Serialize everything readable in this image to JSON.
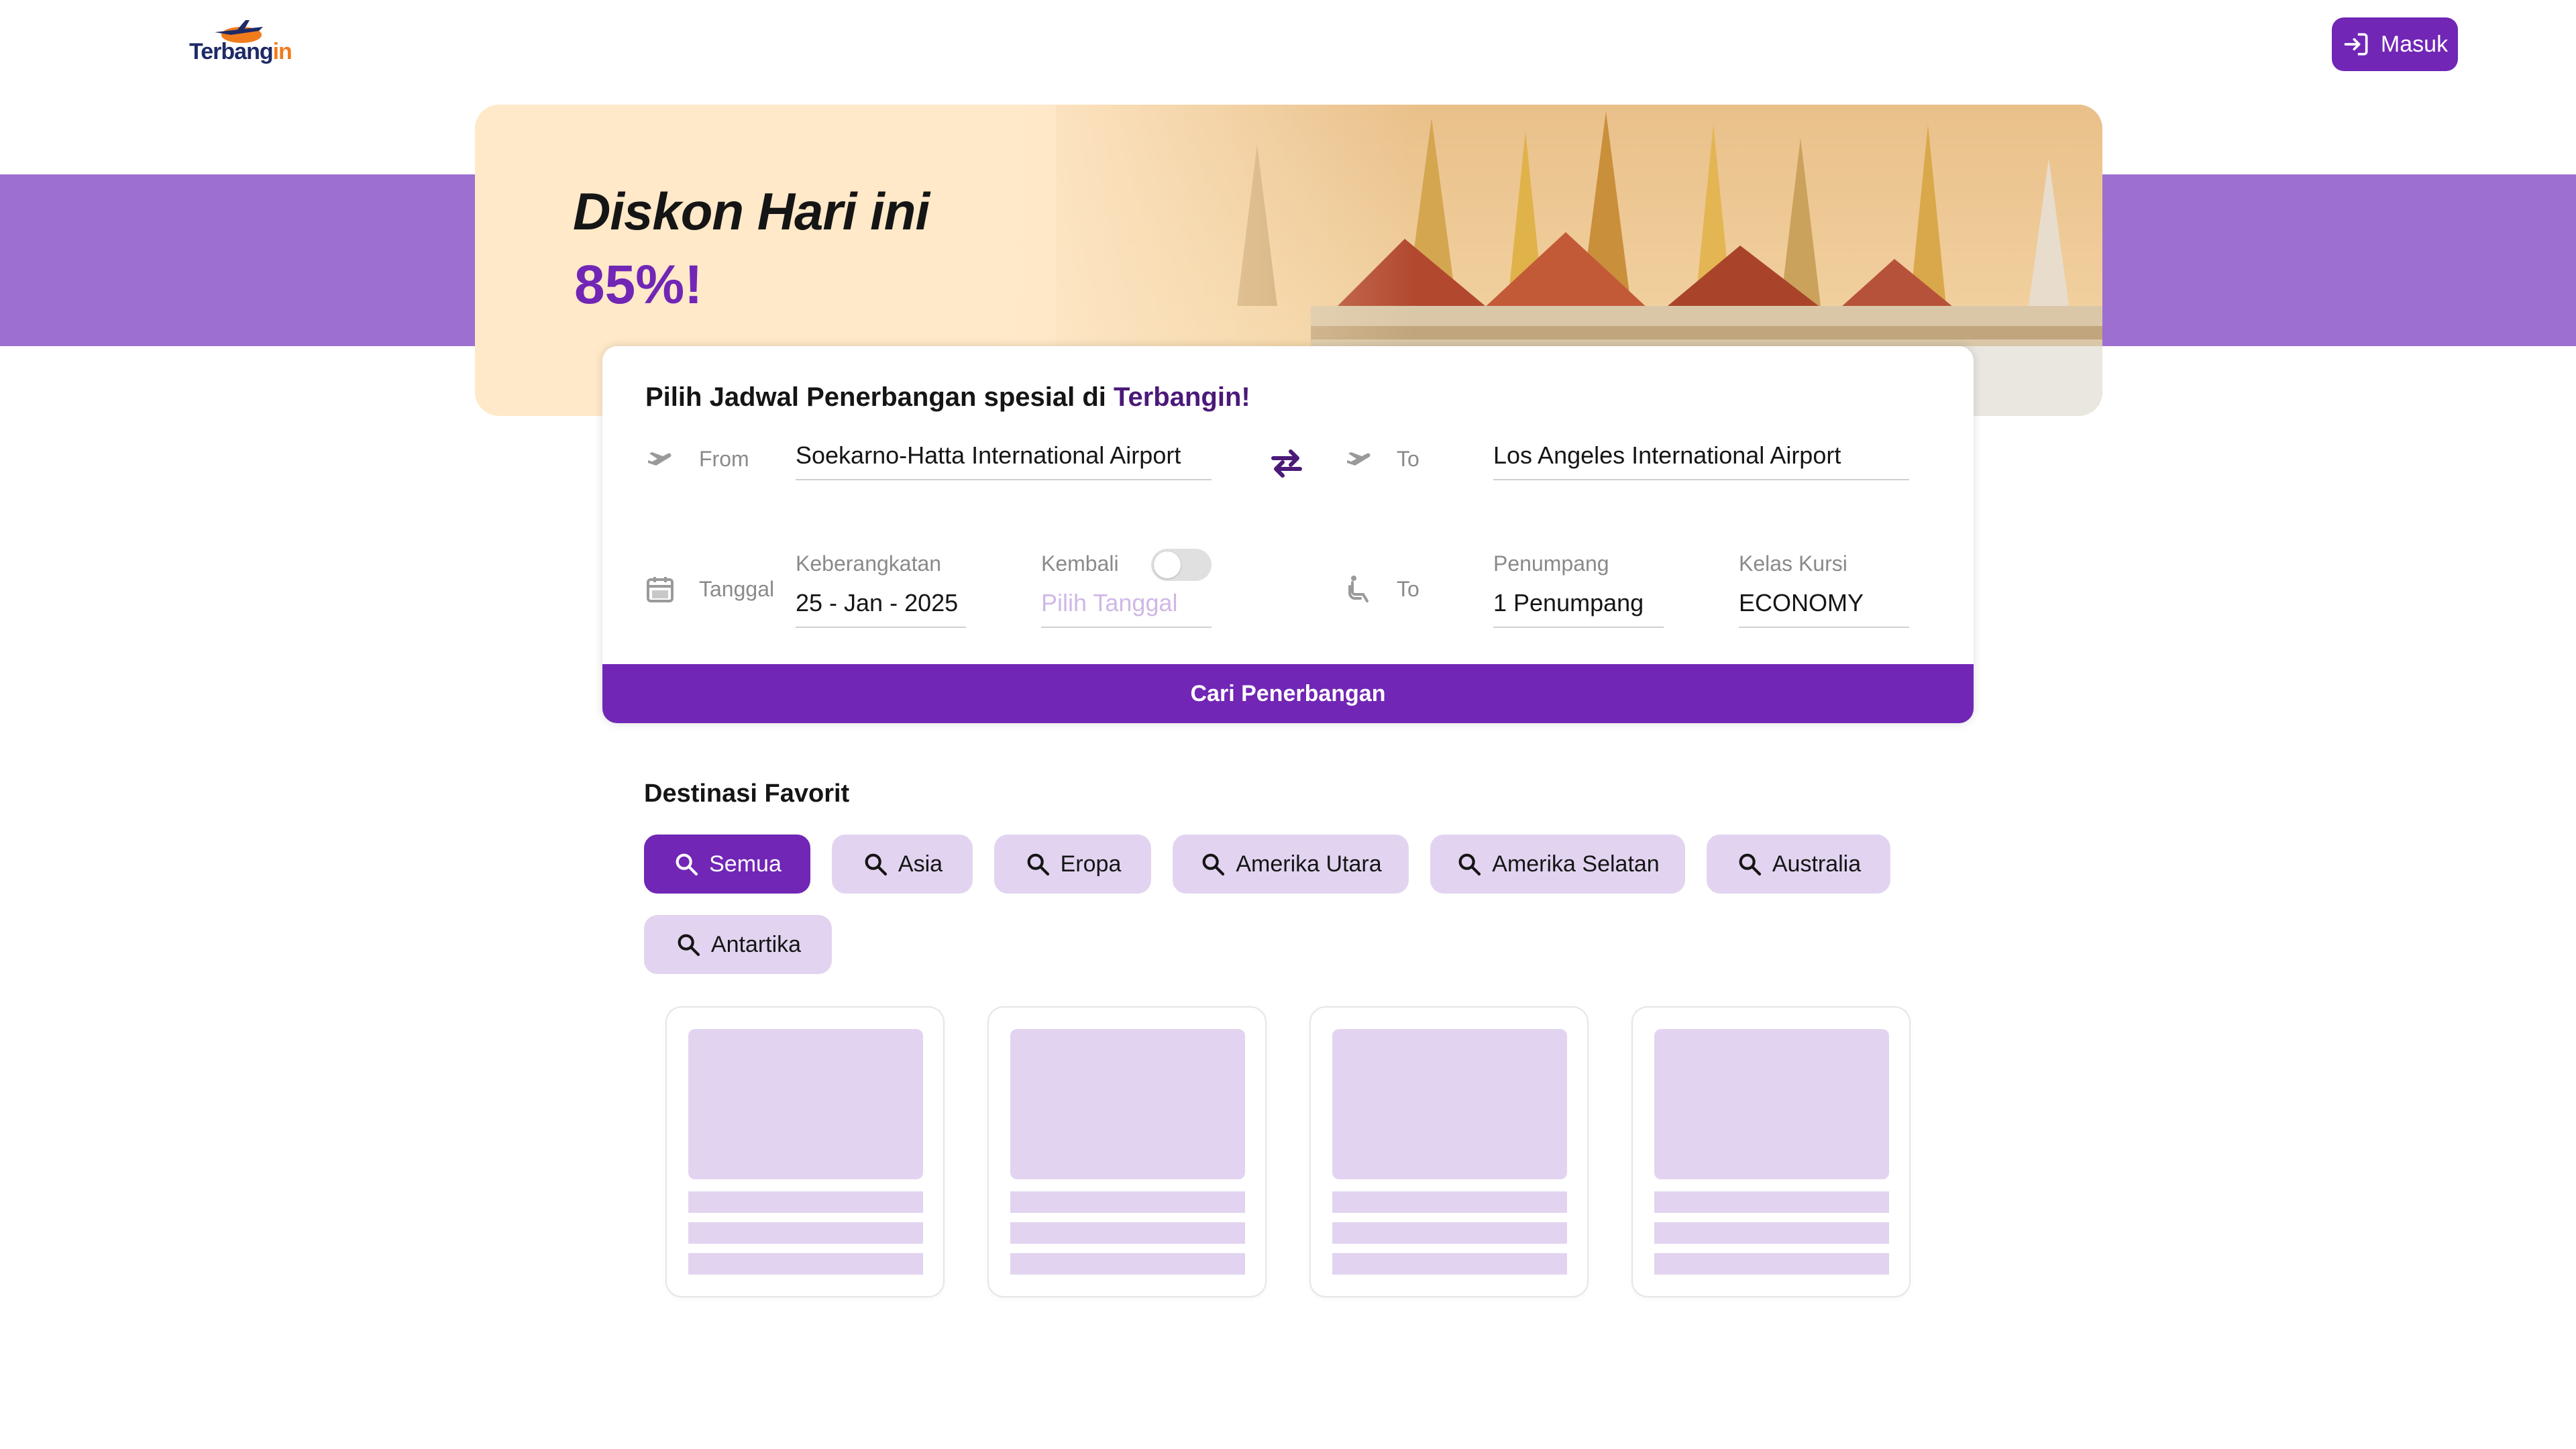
{
  "header": {
    "logo_text_main": "Terbang",
    "logo_text_accent": "in",
    "login_label": "Masuk"
  },
  "banner": {
    "title": "Diskon Hari ini",
    "discount": "85%!"
  },
  "search": {
    "title_prefix": "Pilih Jadwal Penerbangan spesial di ",
    "title_brand": "Terbangin!",
    "from_label": "From",
    "from_value": "Soekarno-Hatta International Airport",
    "to_label": "To",
    "to_value": "Los Angeles International Airport",
    "date_label": "Tanggal",
    "departure_label": "Keberangkatan",
    "departure_value": "25 - Jan - 2025",
    "return_label": "Kembali",
    "return_placeholder": "Pilih Tanggal",
    "return_enabled": false,
    "passenger_row_label": "To",
    "passenger_label": "Penumpang",
    "passenger_value": "1 Penumpang",
    "class_label": "Kelas Kursi",
    "class_value": "ECONOMY",
    "submit_label": "Cari Penerbangan"
  },
  "destinations": {
    "title": "Destinasi Favorit",
    "filters": [
      "Semua",
      "Asia",
      "Eropa",
      "Amerika Utara",
      "Amerika Selatan",
      "Australia",
      "Antartika"
    ],
    "active_filter": "Semua",
    "cards_loading": 4
  },
  "colors": {
    "primary": "#7126b5",
    "stripe": "#9d6fd0",
    "chip_bg": "#e2d4f0",
    "banner_bg": "#ffe9c9"
  },
  "icons": {
    "login": "login-icon",
    "takeoff": "plane-takeoff-icon",
    "swap": "swap-icon",
    "calendar": "calendar-icon",
    "seat": "seat-icon",
    "search": "search-icon"
  }
}
